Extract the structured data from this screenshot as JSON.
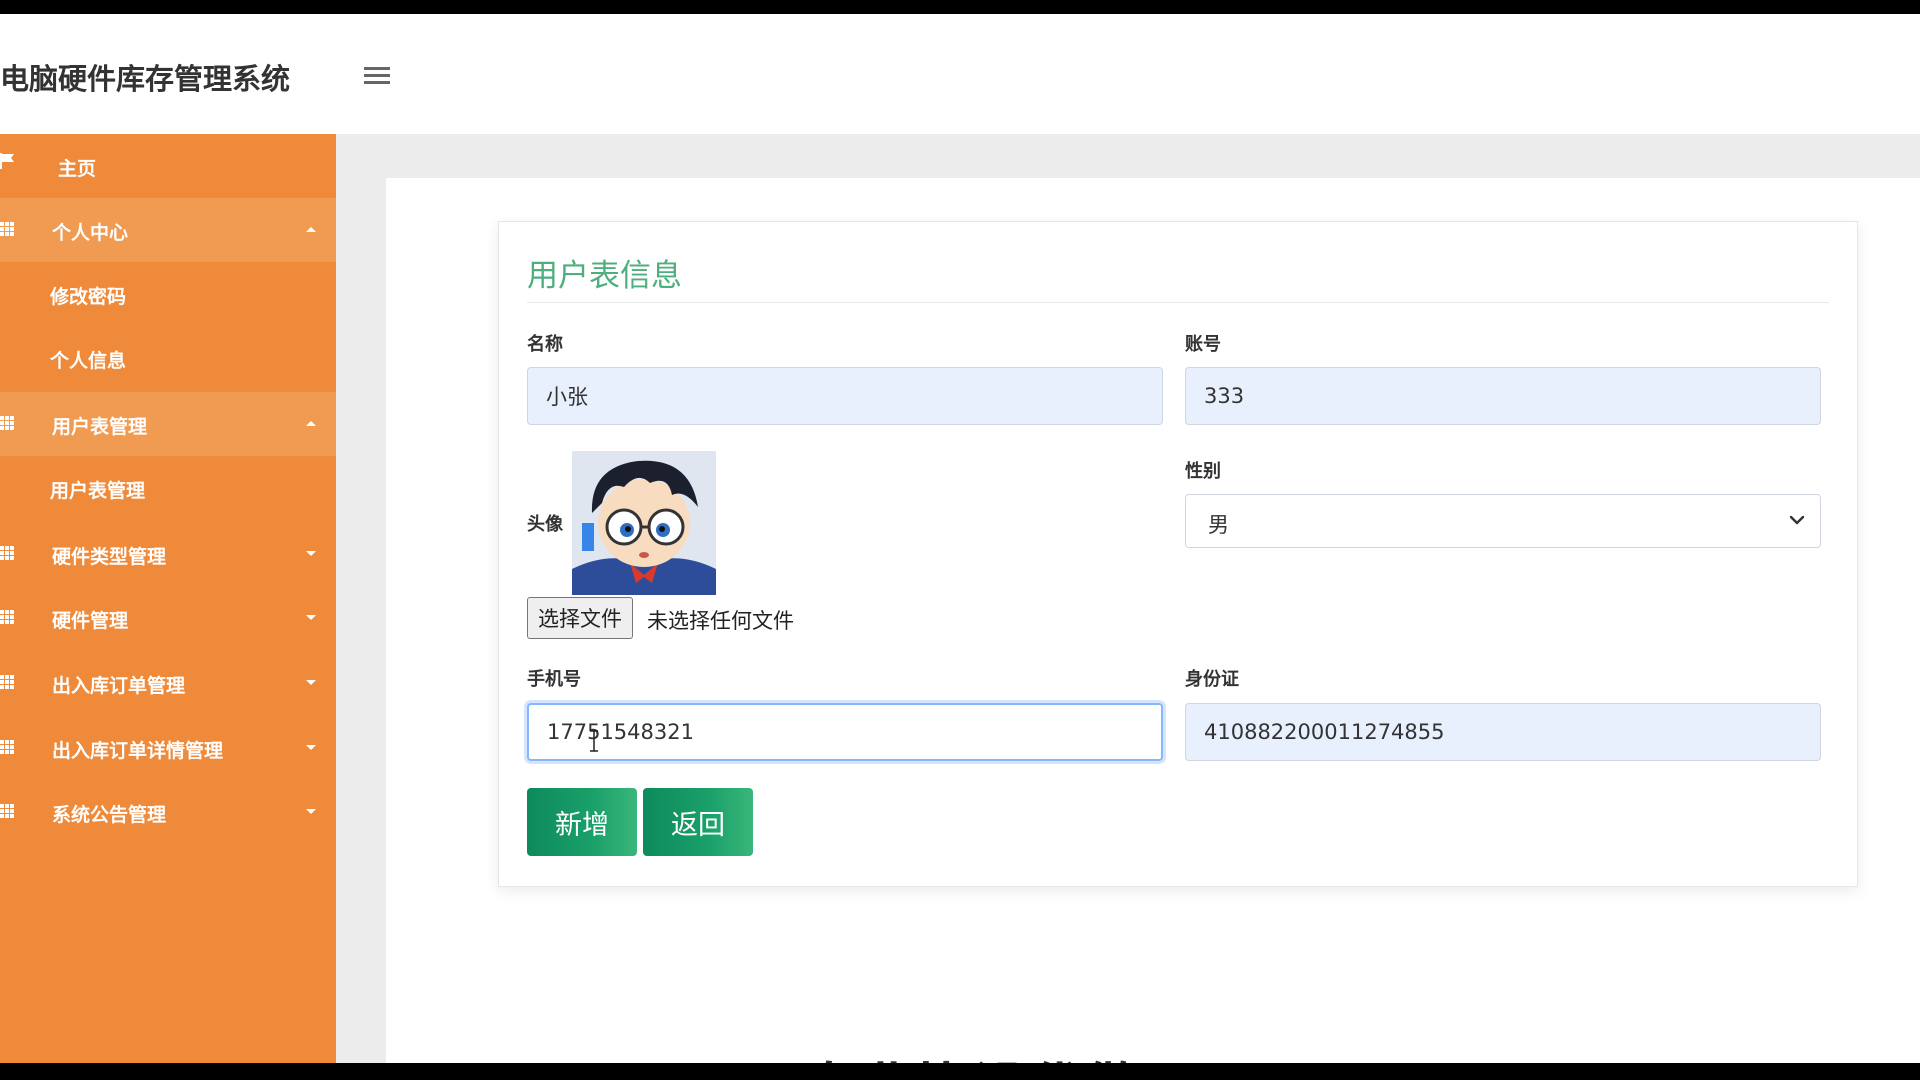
{
  "header": {
    "app_title": "电脑硬件库存管理系统"
  },
  "sidebar": {
    "items": [
      {
        "label": "主页",
        "icon": "flag-icon"
      },
      {
        "label": "个人中心",
        "icon": "grid-icon",
        "expanded": true,
        "children": [
          {
            "label": "修改密码"
          },
          {
            "label": "个人信息"
          }
        ]
      },
      {
        "label": "用户表管理",
        "icon": "grid-icon",
        "expanded": true,
        "children": [
          {
            "label": "用户表管理"
          }
        ]
      },
      {
        "label": "硬件类型管理",
        "icon": "grid-icon",
        "expanded": false
      },
      {
        "label": "硬件管理",
        "icon": "grid-icon",
        "expanded": false
      },
      {
        "label": "出入库订单管理",
        "icon": "grid-icon",
        "expanded": false
      },
      {
        "label": "出入库订单详情管理",
        "icon": "grid-icon",
        "expanded": false
      },
      {
        "label": "系统公告管理",
        "icon": "grid-icon",
        "expanded": false
      }
    ]
  },
  "form": {
    "title": "用户表信息",
    "name_label": "名称",
    "name_value": "小张",
    "account_label": "账号",
    "account_value": "333",
    "avatar_label": "头像",
    "file_button_label": "选择文件",
    "file_status": "未选择任何文件",
    "gender_label": "性别",
    "gender_value": "男",
    "phone_label": "手机号",
    "phone_value": "17751548321",
    "id_label": "身份证",
    "id_value": "410882200011274855",
    "submit_label": "新增",
    "back_label": "返回"
  },
  "overlay": {
    "bottom_caption": "专业毕设代做"
  },
  "colors": {
    "sidebar_bg": "#ee8a3a",
    "sidebar_active": "#f09a52",
    "title_green": "#4caf7d",
    "button_green": "#0e8a5c",
    "input_bg": "#e8f0fe"
  }
}
